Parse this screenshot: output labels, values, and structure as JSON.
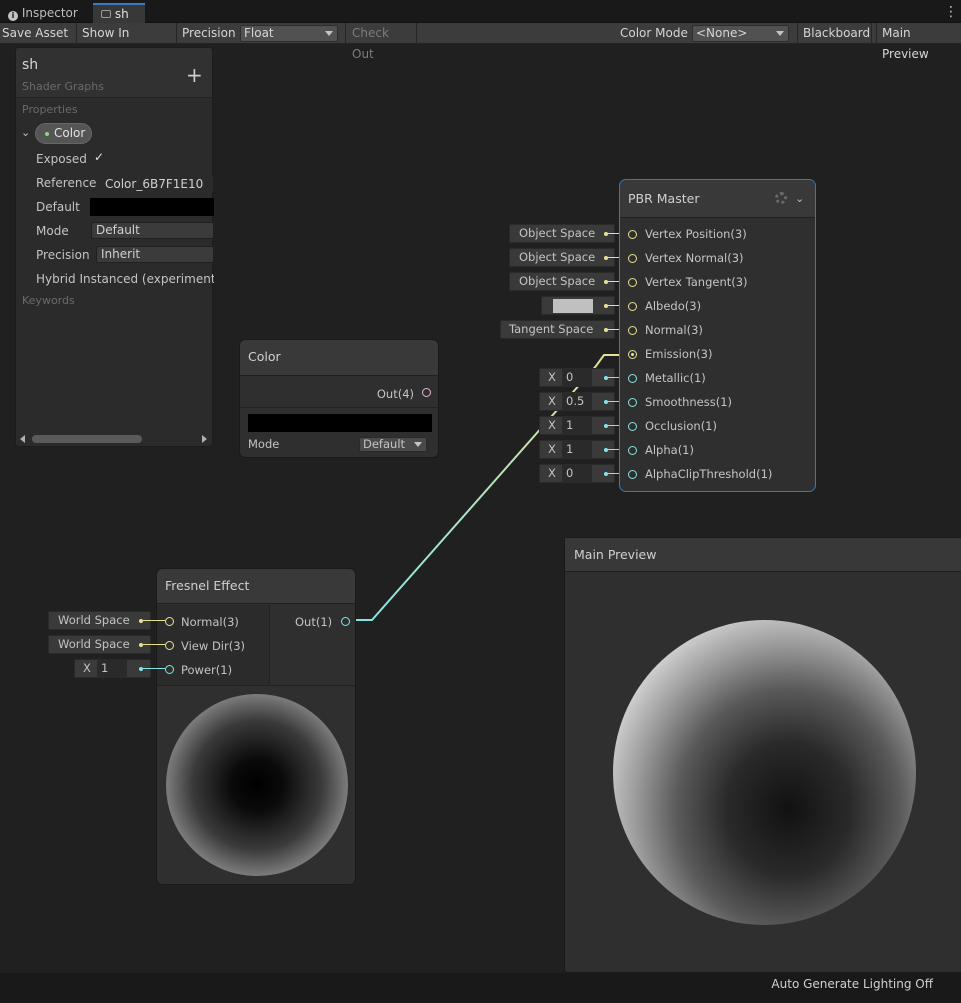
{
  "tabs": [
    {
      "label": "Inspector",
      "icon": "info-icon"
    },
    {
      "label": "sh"
    }
  ],
  "toolbar": {
    "save_asset": "Save Asset",
    "show_in_project": "Show In Project",
    "precision_label": "Precision",
    "precision_value": "Float",
    "check_out": "Check Out",
    "color_mode_label": "Color Mode",
    "color_mode_value": "<None>",
    "blackboard": "Blackboard",
    "main_preview": "Main Preview"
  },
  "blackboard": {
    "title": "sh",
    "subtitle": "Shader Graphs",
    "properties_header": "Properties",
    "property_name": "Color",
    "exposed_label": "Exposed",
    "reference_label": "Reference",
    "reference_value": "Color_6B7F1E10",
    "default_label": "Default",
    "mode_label": "Mode",
    "mode_value": "Default",
    "precision_label": "Precision",
    "precision_value": "Inherit",
    "hybrid_label": "Hybrid Instanced (experimenta",
    "keywords_header": "Keywords"
  },
  "color_node": {
    "title": "Color",
    "out_label": "Out(4)",
    "mode_label": "Mode",
    "mode_value": "Default",
    "swatch": "#000000"
  },
  "pbr_master": {
    "title": "PBR Master",
    "ports": [
      {
        "label": "Vertex Position(3)",
        "input": "Object Space"
      },
      {
        "label": "Vertex Normal(3)",
        "input": "Object Space"
      },
      {
        "label": "Vertex Tangent(3)",
        "input": "Object Space"
      },
      {
        "label": "Albedo(3)",
        "input": ""
      },
      {
        "label": "Normal(3)",
        "input": "Tangent Space"
      },
      {
        "label": "Emission(3)",
        "input": ""
      },
      {
        "label": "Metallic(1)",
        "x": "X",
        "input": "0"
      },
      {
        "label": "Smoothness(1)",
        "x": "X",
        "input": "0.5"
      },
      {
        "label": "Occlusion(1)",
        "x": "X",
        "input": "1"
      },
      {
        "label": "Alpha(1)",
        "x": "X",
        "input": "1"
      },
      {
        "label": "AlphaClipThreshold(1)",
        "x": "X",
        "input": "0"
      }
    ]
  },
  "fresnel": {
    "title": "Fresnel Effect",
    "inputs": [
      {
        "label": "Normal(3)",
        "input": "World Space"
      },
      {
        "label": "View Dir(3)",
        "input": "World Space"
      },
      {
        "label": "Power(1)",
        "x": "X",
        "input": "1"
      }
    ],
    "out_label": "Out(1)"
  },
  "main_preview": {
    "title": "Main Preview"
  },
  "status": {
    "text": "Auto Generate Lighting Off"
  },
  "colors": {
    "accent": "#3a79bb",
    "vector3": "#e8e290",
    "vector1": "#84e4e7",
    "vector4": "#e9b4d2"
  }
}
